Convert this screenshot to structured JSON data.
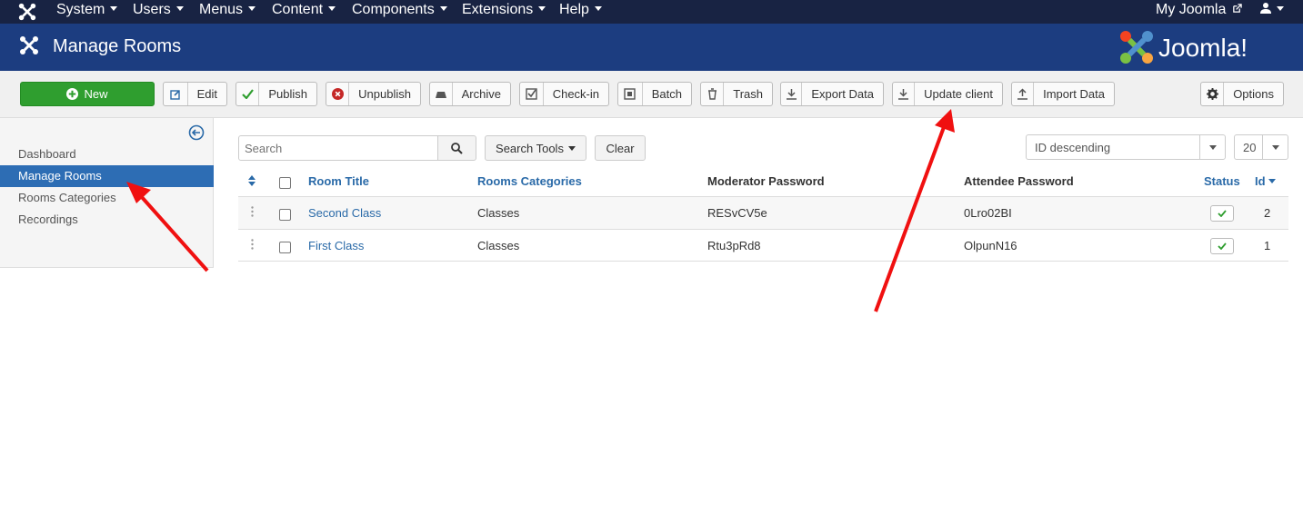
{
  "topnav": {
    "items": [
      "System",
      "Users",
      "Menus",
      "Content",
      "Components",
      "Extensions",
      "Help"
    ],
    "my_joomla": "My Joomla"
  },
  "header": {
    "title": "Manage Rooms",
    "brand": "Joomla!"
  },
  "toolbar": {
    "new": "New",
    "edit": "Edit",
    "publish": "Publish",
    "unpublish": "Unpublish",
    "archive": "Archive",
    "checkin": "Check-in",
    "batch": "Batch",
    "trash": "Trash",
    "export": "Export Data",
    "update": "Update client",
    "import": "Import Data",
    "options": "Options"
  },
  "sidebar": {
    "items": [
      "Dashboard",
      "Manage Rooms",
      "Rooms Categories",
      "Recordings"
    ],
    "active": "Manage Rooms"
  },
  "filters": {
    "search_placeholder": "Search",
    "search_tools": "Search Tools",
    "clear": "Clear",
    "ordering": "ID descending",
    "limit": "20"
  },
  "table": {
    "headers": {
      "title": "Room Title",
      "category": "Rooms Categories",
      "moderator": "Moderator Password",
      "attendee": "Attendee Password",
      "status": "Status",
      "id": "Id"
    },
    "rows": [
      {
        "title": "Second Class",
        "category": "Classes",
        "moderator": "RESvCV5e",
        "attendee": "0Lro02BI",
        "status": "published",
        "id": "2"
      },
      {
        "title": "First Class",
        "category": "Classes",
        "moderator": "Rtu3pRd8",
        "attendee": "OlpunN16",
        "status": "published",
        "id": "1"
      }
    ]
  },
  "colors": {
    "topnav": "#182343",
    "header": "#1c3d80",
    "active": "#2d6db4",
    "new_button": "#2f9e2f",
    "link": "#2a6aa8",
    "annotation_arrow": "#f01010"
  }
}
